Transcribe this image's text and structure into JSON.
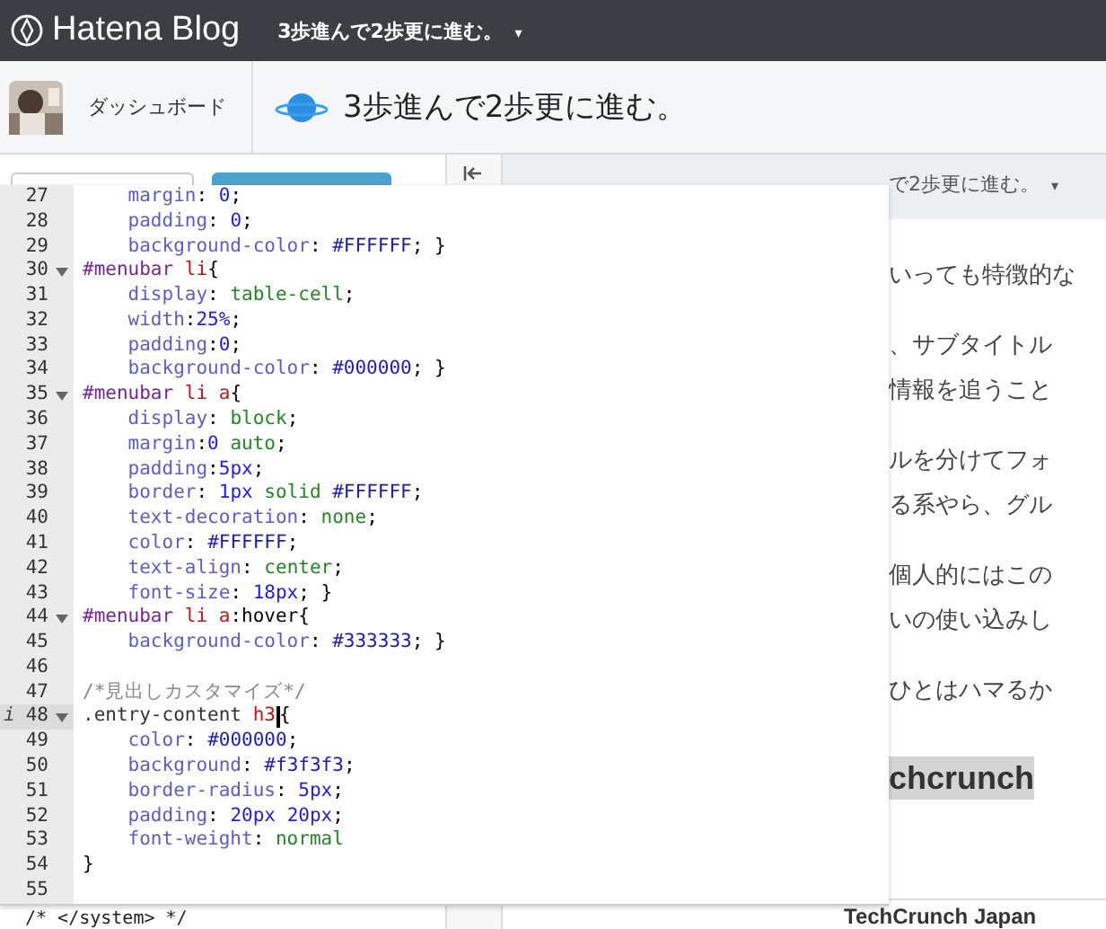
{
  "topbar": {
    "logo": "Hatena Blog",
    "blog_title": "3歩進んで2歩更に進む。",
    "caret": "▾"
  },
  "header": {
    "dashboard": "ダッシュボード",
    "title": "3歩進んで2歩更に進む。"
  },
  "preview": {
    "blog_title": "で2歩更に進む。",
    "caret": "▾",
    "paragraphs": [
      [
        "いっても特徴的な"
      ],
      [
        "、サブタイトル",
        "情報を追うこと"
      ],
      [
        "ルを分けてフォ",
        "る系やら、グル"
      ],
      [
        "個人的にはこの",
        "いの使い込みし"
      ],
      [
        "ひとはハマるか"
      ]
    ],
    "heading": "chcrunch",
    "next_heading": "TechCrunch Japan"
  },
  "source_tail": "/* </system> */",
  "editor": {
    "lines": [
      {
        "num": "27",
        "fold": false,
        "cursor": false,
        "code": "    margin: 0;"
      },
      {
        "num": "28",
        "fold": false,
        "cursor": false,
        "code": "    padding: 0;"
      },
      {
        "num": "29",
        "fold": false,
        "cursor": false,
        "code": "    background-color: #FFFFFF; }"
      },
      {
        "num": "30",
        "fold": true,
        "cursor": false,
        "code": "#menubar li{"
      },
      {
        "num": "31",
        "fold": false,
        "cursor": false,
        "code": "    display: table-cell;"
      },
      {
        "num": "32",
        "fold": false,
        "cursor": false,
        "code": "    width:25%;"
      },
      {
        "num": "33",
        "fold": false,
        "cursor": false,
        "code": "    padding:0;"
      },
      {
        "num": "34",
        "fold": false,
        "cursor": false,
        "code": "    background-color: #000000; }"
      },
      {
        "num": "35",
        "fold": true,
        "cursor": false,
        "code": "#menubar li a{"
      },
      {
        "num": "36",
        "fold": false,
        "cursor": false,
        "code": "    display: block;"
      },
      {
        "num": "37",
        "fold": false,
        "cursor": false,
        "code": "    margin:0 auto;"
      },
      {
        "num": "38",
        "fold": false,
        "cursor": false,
        "code": "    padding:5px;"
      },
      {
        "num": "39",
        "fold": false,
        "cursor": false,
        "code": "    border: 1px solid #FFFFFF;"
      },
      {
        "num": "40",
        "fold": false,
        "cursor": false,
        "code": "    text-decoration: none;"
      },
      {
        "num": "41",
        "fold": false,
        "cursor": false,
        "code": "    color: #FFFFFF;"
      },
      {
        "num": "42",
        "fold": false,
        "cursor": false,
        "code": "    text-align: center;"
      },
      {
        "num": "43",
        "fold": false,
        "cursor": false,
        "code": "    font-size: 18px; }"
      },
      {
        "num": "44",
        "fold": true,
        "cursor": false,
        "code": "#menubar li a:hover{"
      },
      {
        "num": "45",
        "fold": false,
        "cursor": false,
        "code": "    background-color: #333333; }"
      },
      {
        "num": "46",
        "fold": false,
        "cursor": false
      },
      {
        "num": "47",
        "fold": false,
        "cursor": false,
        "code": "/*見出しカスタマイズ*/"
      },
      {
        "num": "48",
        "fold": true,
        "cursor": true,
        "marker": "i",
        "code": ".entry-content h3{"
      },
      {
        "num": "49",
        "fold": false,
        "cursor": false,
        "code": "    color: #000000;"
      },
      {
        "num": "50",
        "fold": false,
        "cursor": false,
        "code": "    background: #f3f3f3;"
      },
      {
        "num": "51",
        "fold": false,
        "cursor": false,
        "code": "    border-radius: 5px;"
      },
      {
        "num": "52",
        "fold": false,
        "cursor": false,
        "code": "    padding: 20px 20px;"
      },
      {
        "num": "53",
        "fold": false,
        "cursor": false,
        "code": "    font-weight: normal"
      },
      {
        "num": "54",
        "fold": false,
        "cursor": false,
        "code": "}"
      },
      {
        "num": "55",
        "fold": false,
        "cursor": false
      }
    ]
  }
}
